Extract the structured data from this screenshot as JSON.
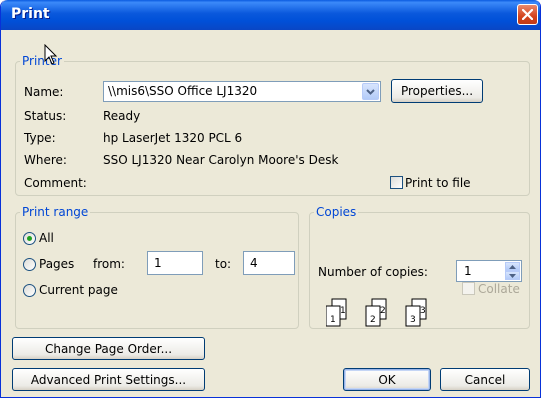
{
  "window": {
    "title": "Print"
  },
  "printer": {
    "group_label": "Printer",
    "name_label": "Name:",
    "name_value": "\\\\mis6\\SSO Office LJ1320",
    "properties_button": "Properties...",
    "status_label": "Status:",
    "status_value": "Ready",
    "type_label": "Type:",
    "type_value": "hp LaserJet 1320 PCL 6",
    "where_label": "Where:",
    "where_value": "SSO LJ1320 Near Carolyn Moore's Desk",
    "comment_label": "Comment:",
    "comment_value": "",
    "print_to_file_label": "Print to file",
    "print_to_file_checked": false
  },
  "print_range": {
    "group_label": "Print range",
    "all_label": "All",
    "pages_label": "Pages",
    "from_label": "from:",
    "from_value": "1",
    "to_label": "to:",
    "to_value": "4",
    "current_page_label": "Current page",
    "selected": "All"
  },
  "copies": {
    "group_label": "Copies",
    "number_label": "Number of copies:",
    "number_value": "1",
    "collate_label": "Collate",
    "collate_enabled": false,
    "pages": [
      "1",
      "2",
      "3"
    ]
  },
  "buttons": {
    "change_page_order": "Change Page Order...",
    "advanced_print_settings": "Advanced Print Settings...",
    "ok": "OK",
    "cancel": "Cancel"
  },
  "colors": {
    "title_bar": "#0a58dc",
    "group_label": "#0046d5",
    "dialog_bg": "#ece9d8",
    "close_button": "#d3431d"
  }
}
